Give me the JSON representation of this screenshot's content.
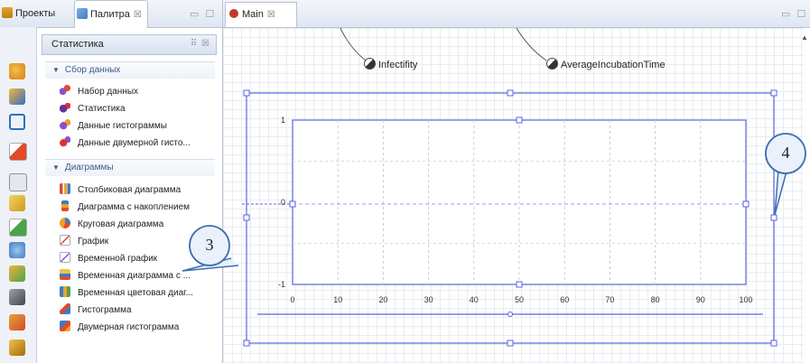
{
  "left_tabs": {
    "projects": "Проекты",
    "palette": "Палитра",
    "palette_close": "☒",
    "window_buttons": "▭ ☐"
  },
  "palette": {
    "title": "Статистика",
    "header_controls": "⠿ ☒",
    "groups": [
      {
        "label": "Сбор данных",
        "items": [
          "Набор данных",
          "Статистика",
          "Данные гистограммы",
          "Данные двумерной гисто..."
        ]
      },
      {
        "label": "Диаграммы",
        "items": [
          "Столбиковая диаграмма",
          "Диаграмма с накоплением",
          "Круговая диаграмма",
          "График",
          "Временной график",
          "Временная диаграмма с ...",
          "Временная цветовая диаг...",
          "Гистограмма",
          "Двумерная гистограмма"
        ]
      }
    ]
  },
  "editor": {
    "tab_label": "Main",
    "tab_close": "☒",
    "window_buttons": "▭ ☐",
    "variables": [
      "Infectifity",
      "AverageIncubationTime"
    ]
  },
  "chart_data": {
    "type": "line",
    "x_ticks": [
      "0",
      "10",
      "20",
      "30",
      "40",
      "50",
      "60",
      "70",
      "80",
      "90",
      "100"
    ],
    "y_ticks": [
      "1",
      "0",
      "-1"
    ],
    "xlim": [
      0,
      100
    ],
    "ylim": [
      -1,
      1
    ],
    "grid": true,
    "series": []
  },
  "callouts": [
    "3",
    "4"
  ],
  "colors": {
    "selection": "#5b63e0",
    "callout_border": "#3d6fae",
    "canvas_grid": "#e9ecf1"
  }
}
